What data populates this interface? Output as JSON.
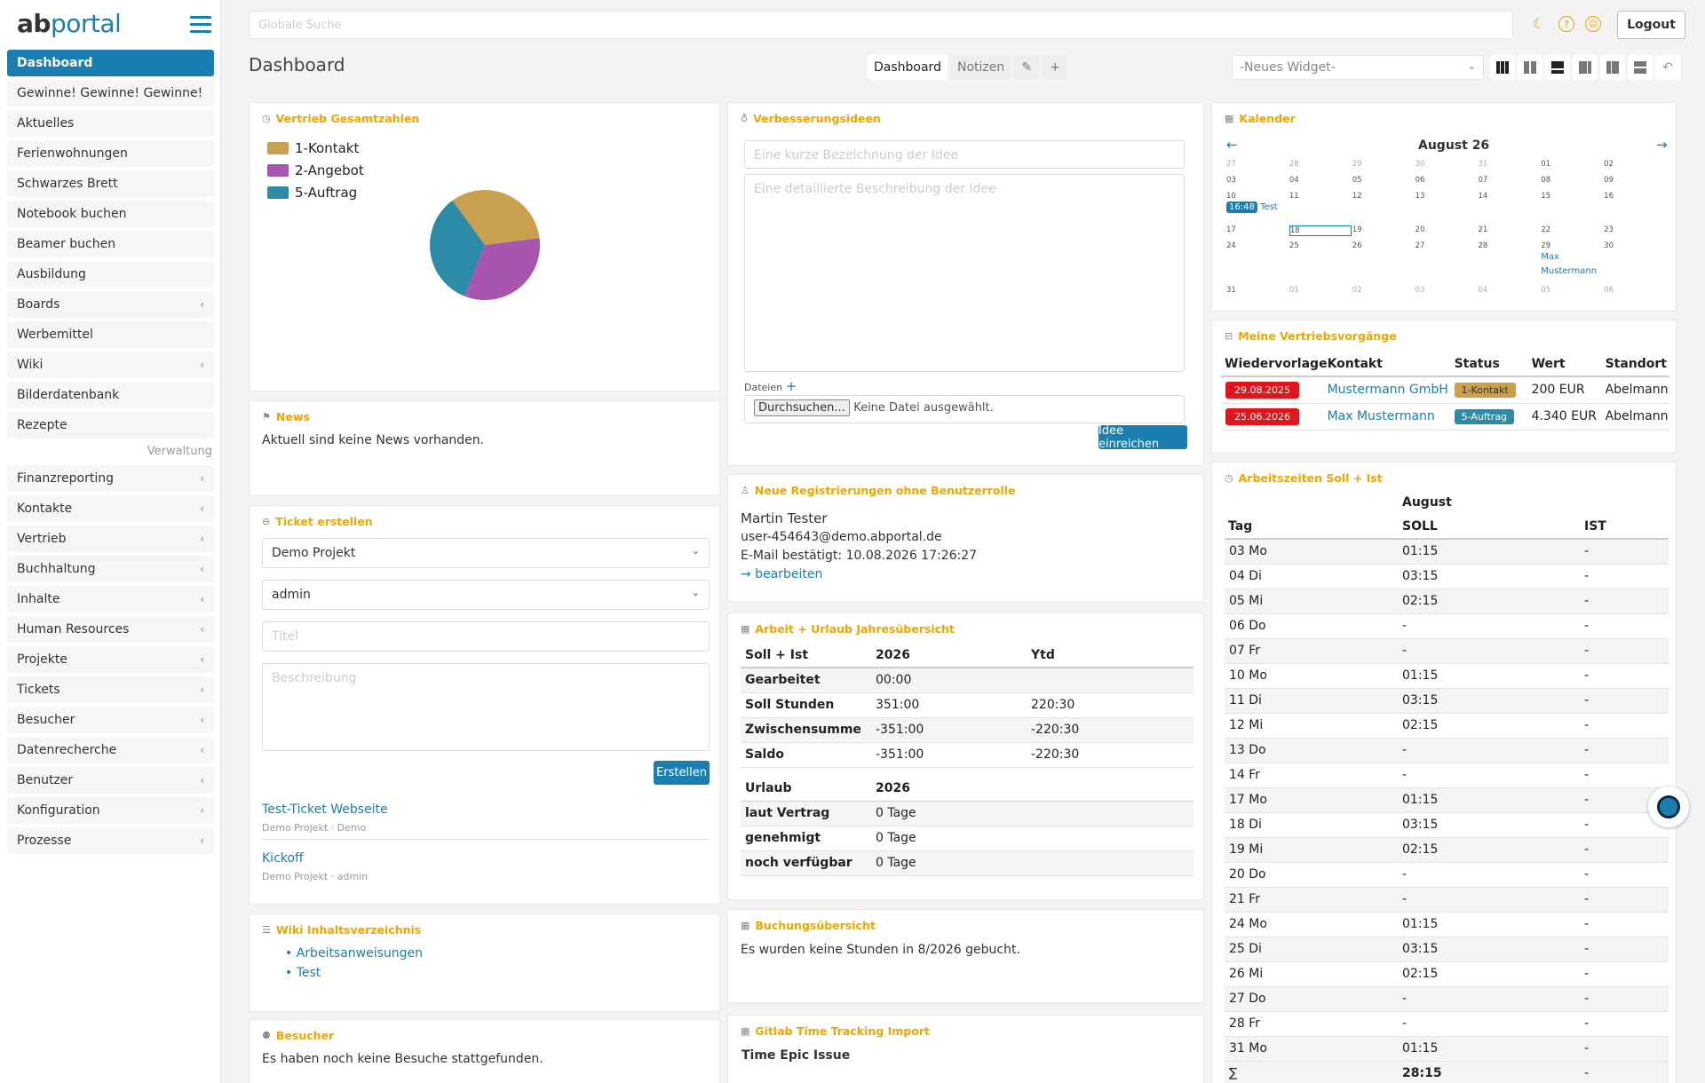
{
  "app": {
    "logo_a": "ab",
    "logo_b": "portal"
  },
  "search": {
    "placeholder": "Globale Suche"
  },
  "header": {
    "logout": "Logout"
  },
  "nav": {
    "items": [
      {
        "label": "Dashboard",
        "active": true,
        "sub": false
      },
      {
        "label": "Gewinne! Gewinne! Gewinne!",
        "sub": false
      },
      {
        "label": "Aktuelles",
        "sub": false
      },
      {
        "label": "Ferienwohnungen",
        "sub": false
      },
      {
        "label": "Schwarzes Brett",
        "sub": false
      },
      {
        "label": "Notebook buchen",
        "sub": false
      },
      {
        "label": "Beamer buchen",
        "sub": false
      },
      {
        "label": "Ausbildung",
        "sub": false
      },
      {
        "label": "Boards",
        "sub": true
      },
      {
        "label": "Werbemittel",
        "sub": false
      },
      {
        "label": "Wiki",
        "sub": true
      },
      {
        "label": "Bilderdatenbank",
        "sub": false
      },
      {
        "label": "Rezepte",
        "sub": false
      }
    ],
    "section": "Verwaltung",
    "admin_items": [
      {
        "label": "Finanzreporting"
      },
      {
        "label": "Kontakte"
      },
      {
        "label": "Vertrieb"
      },
      {
        "label": "Buchhaltung"
      },
      {
        "label": "Inhalte"
      },
      {
        "label": "Human Resources"
      },
      {
        "label": "Projekte"
      },
      {
        "label": "Tickets"
      },
      {
        "label": "Besucher"
      },
      {
        "label": "Datenrecherche"
      },
      {
        "label": "Benutzer"
      },
      {
        "label": "Konfiguration"
      },
      {
        "label": "Prozesse"
      }
    ]
  },
  "page": {
    "title": "Dashboard"
  },
  "tabs": {
    "dashboard": "Dashboard",
    "notes": "Notizen",
    "edit_icon": "✎",
    "add_icon": "+"
  },
  "widget_select": {
    "value": "-Neues Widget-"
  },
  "vertrieb": {
    "title": "Vertrieb Gesamtzahlen",
    "legend": [
      {
        "label": "1-Kontakt",
        "color": "#c9a04e"
      },
      {
        "label": "2-Angebot",
        "color": "#a855b0"
      },
      {
        "label": "5-Auftrag",
        "color": "#2e8ba8"
      }
    ]
  },
  "chart_data": {
    "type": "pie",
    "title": "",
    "categories": [
      "1-Kontakt",
      "2-Angebot",
      "5-Auftrag"
    ],
    "values": [
      33,
      33,
      34
    ],
    "colors": [
      "#c9a04e",
      "#a855b0",
      "#2e8ba8"
    ],
    "legend": "top-left"
  },
  "news": {
    "title": "News",
    "text": "Aktuell sind keine News vorhanden."
  },
  "ticket": {
    "title": "Ticket erstellen",
    "project": "Demo Projekt",
    "user": "admin",
    "title_placeholder": "Titel",
    "desc_placeholder": "Beschreibung",
    "submit": "Erstellen",
    "items": [
      {
        "name": "Test-Ticket Webseite",
        "meta": "Demo Projekt · Demo"
      },
      {
        "name": "Kickoff",
        "meta": "Demo Projekt · admin"
      }
    ]
  },
  "wiki": {
    "title": "Wiki Inhaltsverzeichnis",
    "items": [
      "Arbeitsanweisungen",
      "Test"
    ]
  },
  "besucher": {
    "title": "Besucher",
    "text": "Es haben noch keine Besuche stattgefunden."
  },
  "ideen": {
    "title": "Verbesserungsideen",
    "short_placeholder": "Eine kurze Bezeichnung der Idee",
    "long_placeholder": "Eine detaillierte Beschreibung der Idee",
    "files_label": "Dateien",
    "browse": "Durchsuchen...",
    "no_file": "Keine Datei ausgewählt.",
    "submit": "Idee einreichen"
  },
  "registrierungen": {
    "title": "Neue Registrierungen ohne Benutzerrolle",
    "name": "Martin Tester",
    "email": "user-454643@demo.abportal.de",
    "confirmed": "E-Mail bestätigt: 10.08.2026 17:26:27",
    "edit": "→ bearbeiten"
  },
  "arbeit": {
    "title": "Arbeit + Urlaub Jahresübersicht",
    "head": [
      "Soll + Ist",
      "2026",
      "Ytd"
    ],
    "rows": [
      [
        "Gearbeitet",
        "00:00",
        ""
      ],
      [
        "Soll Stunden",
        "351:00",
        "220:30"
      ],
      [
        "Zwischensumme",
        "-351:00",
        "-220:30"
      ],
      [
        "Saldo",
        "-351:00",
        "-220:30"
      ]
    ],
    "urlaub_head": [
      "Urlaub",
      "2026"
    ],
    "urlaub_rows": [
      [
        "laut Vertrag",
        "0 Tage"
      ],
      [
        "genehmigt",
        "0 Tage"
      ],
      [
        "noch verfügbar",
        "0 Tage"
      ]
    ]
  },
  "buchung": {
    "title": "Buchungsübersicht",
    "text": "Es wurden keine Stunden in 8/2026 gebucht."
  },
  "gitlab": {
    "title": "Gitlab Time Tracking Import",
    "head": "Time Epic Issue"
  },
  "kalender": {
    "title": "Kalender",
    "month": "August 26",
    "prev": "←",
    "next": "→",
    "weeks": [
      [
        "27",
        "28",
        "29",
        "30",
        "31",
        "01",
        "02"
      ],
      [
        "03",
        "04",
        "05",
        "06",
        "07",
        "08",
        "09"
      ],
      [
        "10",
        "11",
        "12",
        "13",
        "14",
        "15",
        "16"
      ],
      [
        "17",
        "18",
        "19",
        "20",
        "21",
        "22",
        "23"
      ],
      [
        "24",
        "25",
        "26",
        "27",
        "28",
        "29",
        "30"
      ],
      [
        "31",
        "01",
        "02",
        "03",
        "04",
        "05",
        "06"
      ]
    ],
    "event1_time": "16:48",
    "event1_label": "Test",
    "event2_label_a": "Max",
    "event2_label_b": "Mustermann"
  },
  "vorgaenge": {
    "title": "Meine Vertriebsvorgänge",
    "head": [
      "Wiedervorlage",
      "Kontakt",
      "Status",
      "Wert",
      "Standort"
    ],
    "rows": [
      {
        "date": "29.08.2025",
        "contact": "Mustermann GmbH",
        "status": "1-Kontakt",
        "status_color": "#c9a04e",
        "value": "200 EUR",
        "site": "Abelmann"
      },
      {
        "date": "25.06.2026",
        "contact": "Max Mustermann",
        "status": "5-Auftrag",
        "status_color": "#2e8ba8",
        "value": "4.340 EUR",
        "site": "Abelmann"
      }
    ]
  },
  "arbeitszeiten": {
    "title": "Arbeitszeiten Soll + Ist",
    "month": "August",
    "head": [
      "Tag",
      "SOLL",
      "IST"
    ],
    "rows": [
      [
        "03 Mo",
        "01:15",
        "-"
      ],
      [
        "04 Di",
        "03:15",
        "-"
      ],
      [
        "05 Mi",
        "02:15",
        "-"
      ],
      [
        "06 Do",
        "-",
        "-"
      ],
      [
        "07 Fr",
        "-",
        "-"
      ],
      [
        "10 Mo",
        "01:15",
        "-"
      ],
      [
        "11 Di",
        "03:15",
        "-"
      ],
      [
        "12 Mi",
        "02:15",
        "-"
      ],
      [
        "13 Do",
        "-",
        "-"
      ],
      [
        "14 Fr",
        "-",
        "-"
      ],
      [
        "17 Mo",
        "01:15",
        "-"
      ],
      [
        "18 Di",
        "03:15",
        "-"
      ],
      [
        "19 Mi",
        "02:15",
        "-"
      ],
      [
        "20 Do",
        "-",
        "-"
      ],
      [
        "21 Fr",
        "-",
        "-"
      ],
      [
        "24 Mo",
        "01:15",
        "-"
      ],
      [
        "25 Di",
        "03:15",
        "-"
      ],
      [
        "26 Mi",
        "02:15",
        "-"
      ],
      [
        "27 Do",
        "-",
        "-"
      ],
      [
        "28 Fr",
        "-",
        "-"
      ],
      [
        "31 Mo",
        "01:15",
        "-"
      ]
    ],
    "sum": [
      "∑",
      "28:15",
      "-"
    ]
  }
}
